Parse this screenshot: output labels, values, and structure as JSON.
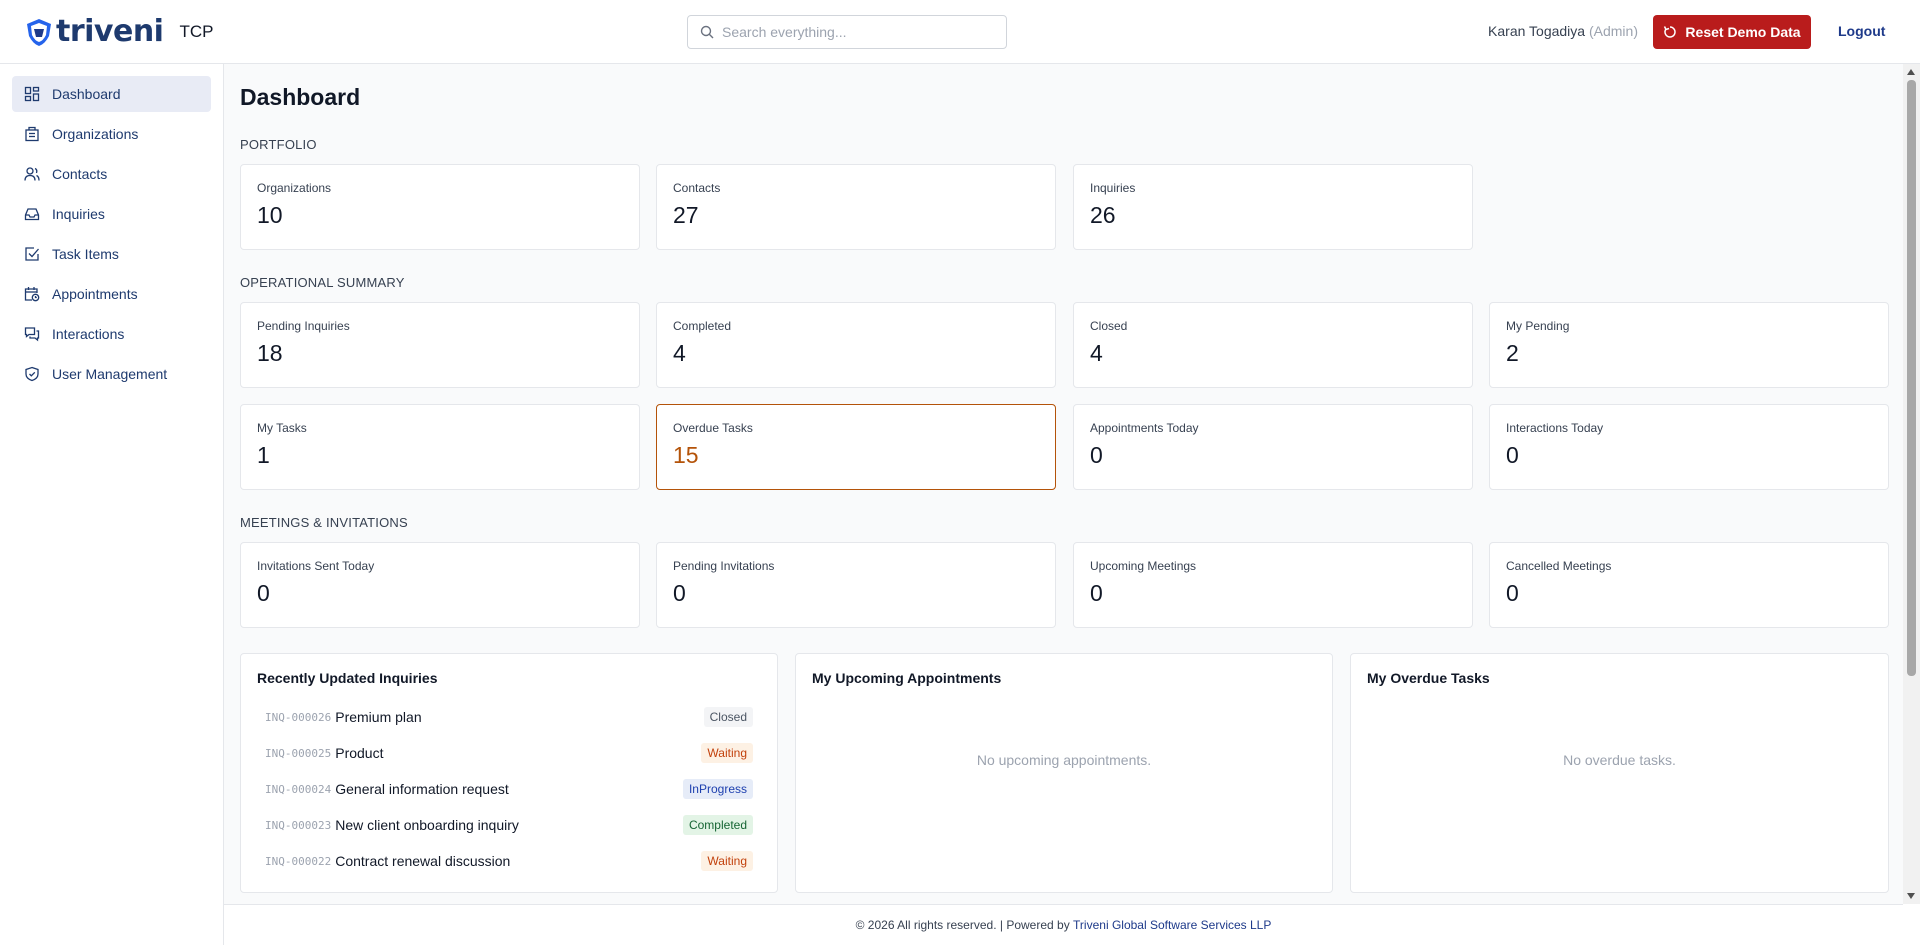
{
  "header": {
    "brand": "triveni",
    "brand_sub": "TCP",
    "search_placeholder": "Search everything...",
    "user_name": "Karan Togadiya",
    "user_role": "(Admin)",
    "reset_label": "Reset Demo Data",
    "logout_label": "Logout"
  },
  "sidebar": {
    "items": [
      {
        "label": "Dashboard",
        "icon": "dashboard-icon",
        "active": true
      },
      {
        "label": "Organizations",
        "icon": "building-icon"
      },
      {
        "label": "Contacts",
        "icon": "users-icon"
      },
      {
        "label": "Inquiries",
        "icon": "inbox-icon"
      },
      {
        "label": "Task Items",
        "icon": "checkbox-icon"
      },
      {
        "label": "Appointments",
        "icon": "calendar-clock-icon"
      },
      {
        "label": "Interactions",
        "icon": "chat-icon"
      },
      {
        "label": "User Management",
        "icon": "shield-icon"
      }
    ]
  },
  "main": {
    "title": "Dashboard",
    "sections": {
      "portfolio": "PORTFOLIO",
      "operational": "OPERATIONAL SUMMARY",
      "meetings": "MEETINGS & INVITATIONS"
    },
    "portfolio": [
      {
        "label": "Organizations",
        "value": "10"
      },
      {
        "label": "Contacts",
        "value": "27"
      },
      {
        "label": "Inquiries",
        "value": "26"
      }
    ],
    "operational": [
      {
        "label": "Pending Inquiries",
        "value": "18"
      },
      {
        "label": "Completed",
        "value": "4"
      },
      {
        "label": "Closed",
        "value": "4"
      },
      {
        "label": "My Pending",
        "value": "2"
      },
      {
        "label": "My Tasks",
        "value": "1"
      },
      {
        "label": "Overdue Tasks",
        "value": "15"
      },
      {
        "label": "Appointments Today",
        "value": "0"
      },
      {
        "label": "Interactions Today",
        "value": "0"
      }
    ],
    "meetings": [
      {
        "label": "Invitations Sent Today",
        "value": "0"
      },
      {
        "label": "Pending Invitations",
        "value": "0"
      },
      {
        "label": "Upcoming Meetings",
        "value": "0"
      },
      {
        "label": "Cancelled Meetings",
        "value": "0"
      }
    ],
    "recent_inquiries": {
      "title": "Recently Updated Inquiries",
      "rows": [
        {
          "code": "INQ-000026",
          "title": "Premium plan",
          "status": "Closed"
        },
        {
          "code": "INQ-000025",
          "title": "Product",
          "status": "Waiting"
        },
        {
          "code": "INQ-000024",
          "title": "General information request",
          "status": "InProgress"
        },
        {
          "code": "INQ-000023",
          "title": "New client onboarding inquiry",
          "status": "Completed"
        },
        {
          "code": "INQ-000022",
          "title": "Contract renewal discussion",
          "status": "Waiting"
        }
      ]
    },
    "appointments": {
      "title": "My Upcoming Appointments",
      "empty": "No upcoming appointments."
    },
    "overdue": {
      "title": "My Overdue Tasks",
      "empty": "No overdue tasks."
    }
  },
  "footer": {
    "text": "© 2026 All rights reserved. | Powered by",
    "company": "Triveni Global Software Services LLP"
  },
  "colors": {
    "brand": "#1e3a6e",
    "danger": "#b91c1c",
    "warning": "#b45309"
  }
}
